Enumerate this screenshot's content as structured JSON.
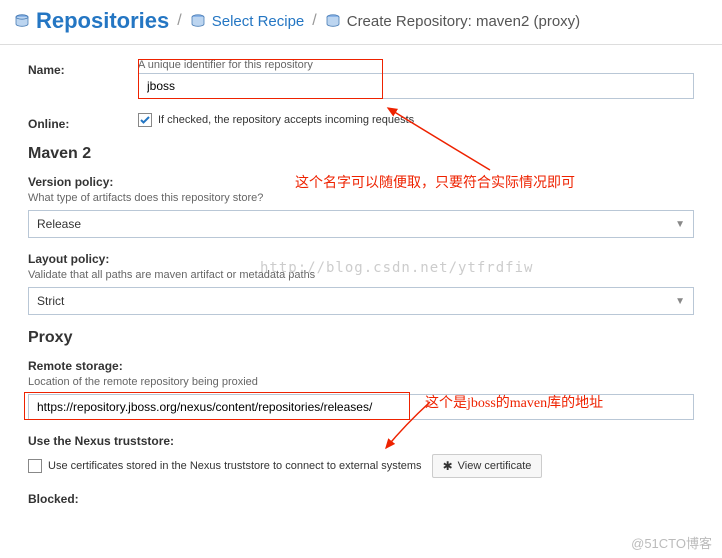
{
  "breadcrumb": {
    "main": "Repositories",
    "step1": "Select Recipe",
    "step2": "Create Repository: maven2 (proxy)"
  },
  "name": {
    "label": "Name:",
    "help": "A unique identifier for this repository",
    "value": "jboss"
  },
  "online": {
    "label": "Online:",
    "text": "If checked, the repository accepts incoming requests"
  },
  "maven2": {
    "title": "Maven 2",
    "version_policy": {
      "label": "Version policy:",
      "help": "What type of artifacts does this repository store?",
      "value": "Release"
    },
    "layout_policy": {
      "label": "Layout policy:",
      "help": "Validate that all paths are maven artifact or metadata paths",
      "value": "Strict"
    }
  },
  "proxy": {
    "title": "Proxy",
    "remote_storage": {
      "label": "Remote storage:",
      "help": "Location of the remote repository being proxied",
      "value": "https://repository.jboss.org/nexus/content/repositories/releases/"
    },
    "truststore": {
      "label": "Use the Nexus truststore:",
      "text": "Use certificates stored in the Nexus truststore to connect to external systems",
      "button": "View certificate"
    },
    "blocked": {
      "label": "Blocked:"
    }
  },
  "annotations": {
    "ann1": "这个名字可以随便取，只要符合实际情况即可",
    "ann2": "这个是jboss的maven库的地址"
  },
  "watermark": "http://blog.csdn.net/ytfrdfiw",
  "footer": "@51CTO博客"
}
